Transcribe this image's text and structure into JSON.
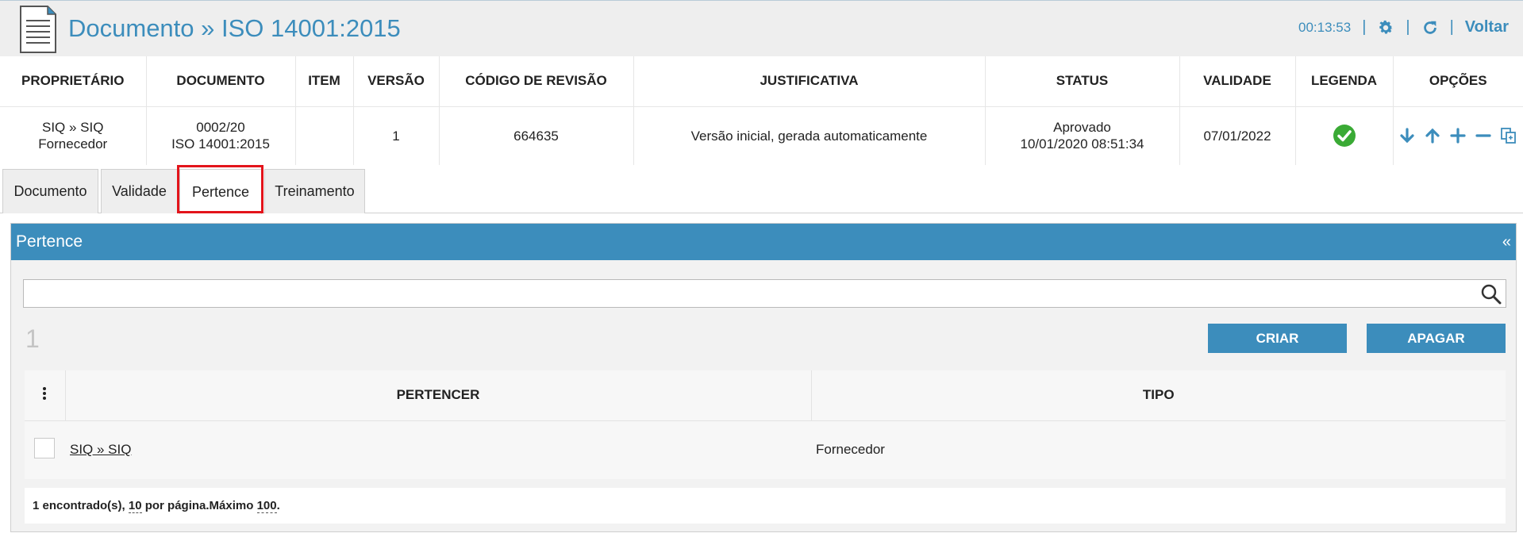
{
  "header": {
    "title": "Documento » ISO 14001:2015",
    "timer": "00:13:53",
    "separator": "|",
    "back_label": "Voltar"
  },
  "table": {
    "columns": [
      "PROPRIETÁRIO",
      "DOCUMENTO",
      "ITEM",
      "VERSÃO",
      "CÓDIGO DE REVISÃO",
      "JUSTIFICATIVA",
      "STATUS",
      "VALIDADE",
      "LEGENDA",
      "OPÇÕES"
    ],
    "row": {
      "owner_line1": "SIQ » SIQ",
      "owner_line2": "Fornecedor",
      "document_line1": "0002/20",
      "document_line2": "ISO 14001:2015",
      "item": "",
      "version": "1",
      "revision_code": "664635",
      "justification": "Versão inicial, gerada automaticamente",
      "status_line1": "Aprovado",
      "status_line2": "10/01/2020 08:51:34",
      "validity": "07/01/2022"
    }
  },
  "tabs": [
    {
      "label": "Documento"
    },
    {
      "label": "Validade"
    },
    {
      "label": "Pertence",
      "active": true
    },
    {
      "label": "Treinamento"
    }
  ],
  "panel": {
    "title": "Pertence",
    "collapse": "«",
    "search_value": "",
    "count": "1",
    "create_label": "CRIAR",
    "delete_label": "APAGAR",
    "grid": {
      "columns": [
        "PERTENCER",
        "TIPO"
      ],
      "rows": [
        {
          "pertencer": "SIQ » SIQ",
          "tipo": "Fornecedor"
        }
      ]
    },
    "footer": {
      "found": "1 encontrado(s),",
      "per_page_value": "10",
      "per_page_text": "por página.Máximo",
      "max_value": "100",
      "end": "."
    }
  },
  "colors": {
    "accent": "#3c8dbc",
    "success": "#3aaa35",
    "highlight": "#e3141b"
  },
  "icons": {
    "document": "document-icon",
    "settings": "gear-icon",
    "refresh": "refresh-icon",
    "legend": "check-circle-icon",
    "options": [
      "arrow-down-icon",
      "arrow-up-icon",
      "plus-icon",
      "minus-icon",
      "copy-icon"
    ],
    "search": "search-icon",
    "menu": "kebab-icon"
  }
}
